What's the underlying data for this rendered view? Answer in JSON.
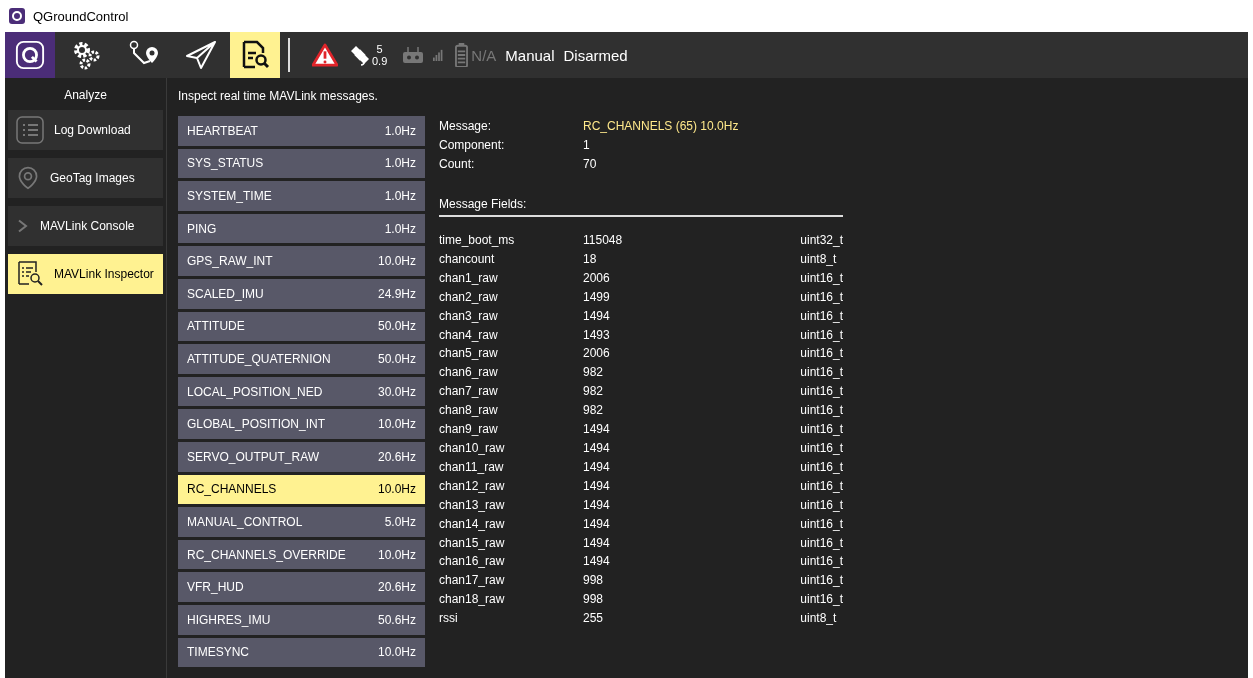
{
  "window": {
    "title": "QGroundControl"
  },
  "toolbar": {
    "tools": [
      {
        "kind": "logo",
        "selected": false
      },
      {
        "kind": "gears",
        "selected": false
      },
      {
        "kind": "plan",
        "selected": false
      },
      {
        "kind": "fly",
        "selected": false
      },
      {
        "kind": "analyze",
        "selected": true
      }
    ],
    "gps": {
      "count": "5",
      "hdop": "0.9"
    },
    "battery": "N/A",
    "mode": "Manual",
    "armed": "Disarmed"
  },
  "sidebar": {
    "title": "Analyze",
    "items": [
      {
        "kind": "list",
        "label": "Log Download",
        "selected": false
      },
      {
        "kind": "pin",
        "label": "GeoTag Images",
        "selected": false
      },
      {
        "kind": "chevron",
        "label": "MAVLink Console",
        "selected": false
      },
      {
        "kind": "inspect",
        "label": "MAVLink Inspector",
        "selected": true
      }
    ]
  },
  "description": "Inspect real time MAVLink messages.",
  "messages": [
    {
      "name": "HEARTBEAT",
      "rate": "1.0Hz",
      "selected": false
    },
    {
      "name": "SYS_STATUS",
      "rate": "1.0Hz",
      "selected": false
    },
    {
      "name": "SYSTEM_TIME",
      "rate": "1.0Hz",
      "selected": false
    },
    {
      "name": "PING",
      "rate": "1.0Hz",
      "selected": false
    },
    {
      "name": "GPS_RAW_INT",
      "rate": "10.0Hz",
      "selected": false
    },
    {
      "name": "SCALED_IMU",
      "rate": "24.9Hz",
      "selected": false
    },
    {
      "name": "ATTITUDE",
      "rate": "50.0Hz",
      "selected": false
    },
    {
      "name": "ATTITUDE_QUATERNION",
      "rate": "50.0Hz",
      "selected": false
    },
    {
      "name": "LOCAL_POSITION_NED",
      "rate": "30.0Hz",
      "selected": false
    },
    {
      "name": "GLOBAL_POSITION_INT",
      "rate": "10.0Hz",
      "selected": false
    },
    {
      "name": "SERVO_OUTPUT_RAW",
      "rate": "20.6Hz",
      "selected": false
    },
    {
      "name": "RC_CHANNELS",
      "rate": "10.0Hz",
      "selected": true
    },
    {
      "name": "MANUAL_CONTROL",
      "rate": "5.0Hz",
      "selected": false
    },
    {
      "name": "RC_CHANNELS_OVERRIDE",
      "rate": "10.0Hz",
      "selected": false
    },
    {
      "name": "VFR_HUD",
      "rate": "20.6Hz",
      "selected": false
    },
    {
      "name": "HIGHRES_IMU",
      "rate": "50.6Hz",
      "selected": false
    },
    {
      "name": "TIMESYNC",
      "rate": "10.0Hz",
      "selected": false
    }
  ],
  "detail": {
    "info": [
      {
        "label": "Message:",
        "value": "RC_CHANNELS (65) 10.0Hz",
        "highlight": true
      },
      {
        "label": "Component:",
        "value": "1",
        "highlight": false
      },
      {
        "label": "Count:",
        "value": "70",
        "highlight": false
      }
    ],
    "fields_title": "Message Fields:",
    "fields": [
      {
        "name": "time_boot_ms",
        "value": "115048",
        "type": "uint32_t"
      },
      {
        "name": "chancount",
        "value": "18",
        "type": "uint8_t"
      },
      {
        "name": "chan1_raw",
        "value": "2006",
        "type": "uint16_t"
      },
      {
        "name": "chan2_raw",
        "value": "1499",
        "type": "uint16_t"
      },
      {
        "name": "chan3_raw",
        "value": "1494",
        "type": "uint16_t"
      },
      {
        "name": "chan4_raw",
        "value": "1493",
        "type": "uint16_t"
      },
      {
        "name": "chan5_raw",
        "value": "2006",
        "type": "uint16_t"
      },
      {
        "name": "chan6_raw",
        "value": "982",
        "type": "uint16_t"
      },
      {
        "name": "chan7_raw",
        "value": "982",
        "type": "uint16_t"
      },
      {
        "name": "chan8_raw",
        "value": "982",
        "type": "uint16_t"
      },
      {
        "name": "chan9_raw",
        "value": "1494",
        "type": "uint16_t"
      },
      {
        "name": "chan10_raw",
        "value": "1494",
        "type": "uint16_t"
      },
      {
        "name": "chan11_raw",
        "value": "1494",
        "type": "uint16_t"
      },
      {
        "name": "chan12_raw",
        "value": "1494",
        "type": "uint16_t"
      },
      {
        "name": "chan13_raw",
        "value": "1494",
        "type": "uint16_t"
      },
      {
        "name": "chan14_raw",
        "value": "1494",
        "type": "uint16_t"
      },
      {
        "name": "chan15_raw",
        "value": "1494",
        "type": "uint16_t"
      },
      {
        "name": "chan16_raw",
        "value": "1494",
        "type": "uint16_t"
      },
      {
        "name": "chan17_raw",
        "value": "998",
        "type": "uint16_t"
      },
      {
        "name": "chan18_raw",
        "value": "998",
        "type": "uint16_t"
      },
      {
        "name": "rssi",
        "value": "255",
        "type": "uint8_t"
      }
    ]
  }
}
